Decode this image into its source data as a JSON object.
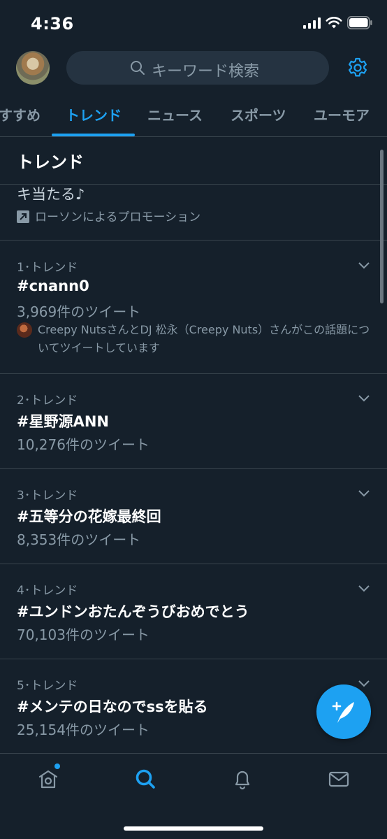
{
  "status_bar": {
    "time": "4:36"
  },
  "header": {
    "search_placeholder": "キーワード検索"
  },
  "tabs": [
    {
      "label": "すすめ",
      "active": false
    },
    {
      "label": "トレンド",
      "active": true
    },
    {
      "label": "ニュース",
      "active": false
    },
    {
      "label": "スポーツ",
      "active": false
    },
    {
      "label": "ユーモア",
      "active": false
    }
  ],
  "section": {
    "title": "トレンド"
  },
  "promoted": {
    "text": "キ当たる♪",
    "promoted_by": "ローソンによるプロモーション"
  },
  "trends": [
    {
      "meta": "1･トレンド",
      "name": "#cnann0",
      "count": "3,969件のツイート",
      "context": "Creepy NutsさんとDJ 松永（Creepy Nuts）さんがこの話題についてツイートしています"
    },
    {
      "meta": "2･トレンド",
      "name": "#星野源ANN",
      "count": "10,276件のツイート"
    },
    {
      "meta": "3･トレンド",
      "name": "#五等分の花嫁最終回",
      "count": "8,353件のツイート"
    },
    {
      "meta": "4･トレンド",
      "name": "#ユンドンおたんぞうびおめでとう",
      "count": "70,103件のツイート"
    },
    {
      "meta": "5･トレンド",
      "name": "#メンテの日なのでssを貼る",
      "count": "25,154件のツイート"
    }
  ],
  "icons": {
    "accent": "#1da1f2",
    "nav": [
      "home-icon",
      "search-icon",
      "bell-icon",
      "mail-icon"
    ]
  }
}
